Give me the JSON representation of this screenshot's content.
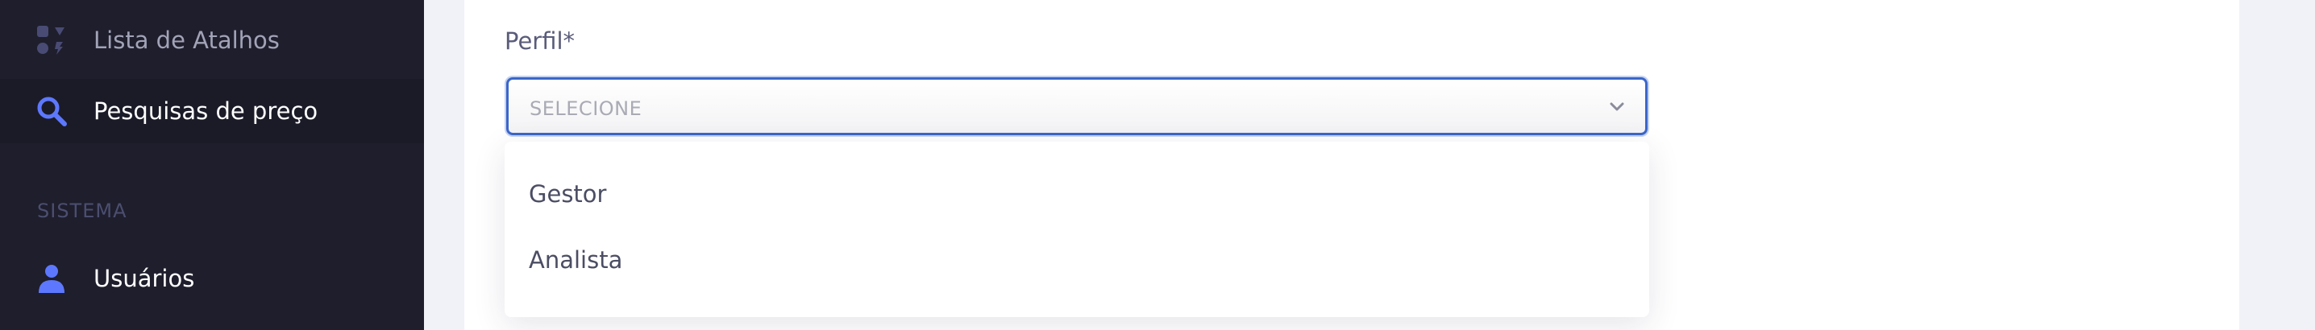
{
  "sidebar": {
    "items": [
      {
        "label": "Lista de Atalhos",
        "icon": "shortcuts-icon"
      },
      {
        "label": "Pesquisas de preço",
        "icon": "search-icon"
      }
    ],
    "section_title": "SISTEMA",
    "system_items": [
      {
        "label": "Usuários",
        "icon": "user-icon"
      }
    ]
  },
  "form": {
    "perfil_label": "Perfil*",
    "perfil_value": "SELECIONE",
    "perfil_options": [
      "Gestor",
      "Analista"
    ]
  },
  "colors": {
    "sidebar_bg": "#1e1e2d",
    "accent": "#3b66c9",
    "icon_accent": "#5d78ff"
  }
}
